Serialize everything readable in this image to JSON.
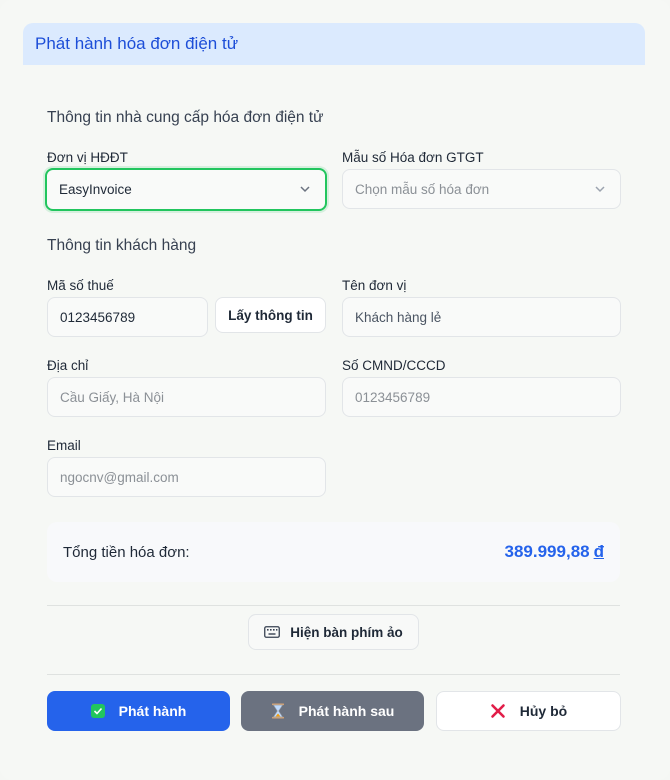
{
  "header": {
    "title": "Phát hành hóa đơn điện tử"
  },
  "provider_section": {
    "title": "Thông tin nhà cung cấp hóa đơn điện tử",
    "unit_label": "Đơn vị HĐĐT",
    "unit_value": "EasyInvoice",
    "template_label": "Mẫu số Hóa đơn GTGT",
    "template_placeholder": "Chọn mẫu số hóa đơn"
  },
  "customer_section": {
    "title": "Thông tin khách hàng",
    "tax_label": "Mã số thuế",
    "tax_value": "0123456789",
    "fetch_button": "Lấy thông tin",
    "company_label": "Tên đơn vị",
    "company_placeholder": "Khách hàng lẻ",
    "address_label": "Địa chỉ",
    "address_placeholder": "Cầu Giấy, Hà Nội",
    "id_label": "Số CMND/CCCD",
    "id_placeholder": "0123456789",
    "email_label": "Email",
    "email_placeholder": "ngocnv@gmail.com"
  },
  "total": {
    "label": "Tổng tiền hóa đơn:",
    "amount": "389.999,88",
    "currency": "đ"
  },
  "keyboard_button": "Hiện bàn phím ảo",
  "actions": {
    "issue": "Phát hành",
    "issue_later": "Phát hành sau",
    "cancel": "Hủy bỏ"
  },
  "colors": {
    "primary": "#2563eb",
    "focus": "#22c55e",
    "header_bg": "#dbeafe",
    "cancel_icon": "#e11d48"
  }
}
